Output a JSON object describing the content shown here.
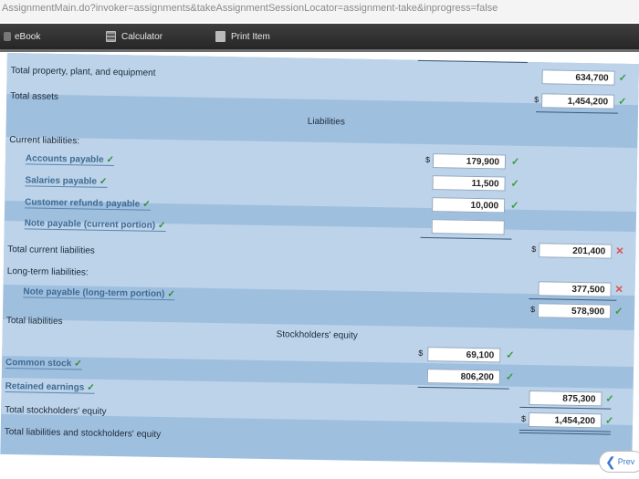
{
  "browser": {
    "url": "AssignmentMain.do?invoker=assignments&takeAssignmentSessionLocator=assignment-take&inprogress=false"
  },
  "toolbar": {
    "ebook": "eBook",
    "calculator": "Calculator",
    "print": "Print Item"
  },
  "balance_sheet": {
    "total_ppe": {
      "label": "Total property, plant, and equipment",
      "value": "634,700",
      "status": "correct"
    },
    "total_assets": {
      "label": "Total assets",
      "currency": "$",
      "value": "1,454,200",
      "status": "correct"
    },
    "liabilities_heading": "Liabilities",
    "current_liabilities_heading": "Current liabilities:",
    "current_items": [
      {
        "label": "Accounts payable",
        "currency": "$",
        "value": "179,900",
        "status": "correct"
      },
      {
        "label": "Salaries payable",
        "currency": "",
        "value": "11,500",
        "status": "correct"
      },
      {
        "label": "Customer refunds payable",
        "currency": "",
        "value": "10,000",
        "status": "correct"
      },
      {
        "label": "Note payable (current portion)",
        "currency": "",
        "value": "",
        "status": ""
      }
    ],
    "total_current_liabilities": {
      "label": "Total current liabilities",
      "currency": "$",
      "value": "201,400",
      "status": "incorrect"
    },
    "long_term_heading": "Long-term liabilities:",
    "long_term_items": [
      {
        "label": "Note payable (long-term portion)",
        "value": "377,500",
        "status": "incorrect"
      }
    ],
    "total_liabilities": {
      "label": "Total liabilities",
      "currency": "$",
      "value": "578,900",
      "status": "correct"
    },
    "equity_heading": "Stockholders' equity",
    "equity_items": [
      {
        "label": "Common stock",
        "currency": "$",
        "value": "69,100",
        "status": "correct"
      },
      {
        "label": "Retained earnings",
        "currency": "",
        "value": "806,200",
        "status": "correct"
      }
    ],
    "total_equity": {
      "label": "Total stockholders' equity",
      "value": "875,300",
      "status": "correct"
    },
    "total_liabilities_equity": {
      "label": "Total liabilities and stockholders' equity",
      "currency": "$",
      "value": "1,454,200",
      "status": "correct"
    }
  },
  "nav": {
    "prev_label": "Prev"
  },
  "icons": {
    "correct": "checkmark-icon",
    "incorrect": "x-mark-icon"
  }
}
